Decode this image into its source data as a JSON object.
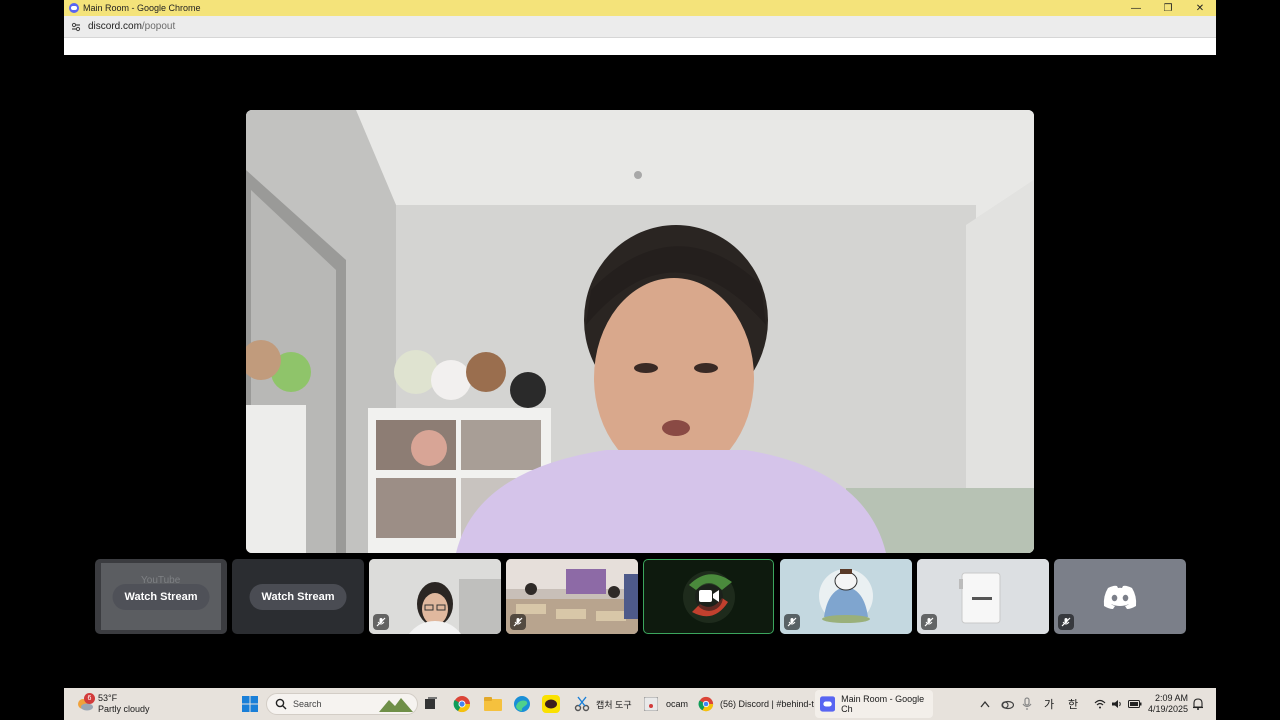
{
  "window": {
    "title": "Main Room - Google Chrome",
    "minimize_glyph": "—",
    "restore_glyph": "❐",
    "close_glyph": "✕"
  },
  "address": {
    "domain": "discord.com",
    "path": "/popout"
  },
  "tiles": [
    {
      "type": "stream",
      "label": "Watch Stream",
      "preview_text": "YouTube"
    },
    {
      "type": "stream",
      "label": "Watch Stream"
    },
    {
      "type": "camera",
      "muted": true
    },
    {
      "type": "camera",
      "muted": true
    },
    {
      "type": "camera-off",
      "selected": true
    },
    {
      "type": "avatar",
      "muted": true
    },
    {
      "type": "avatar",
      "muted": true
    },
    {
      "type": "discord-avatar",
      "muted": true
    }
  ],
  "taskbar": {
    "weather_badge": "6",
    "weather_temp": "53°F",
    "weather_desc": "Partly cloudy",
    "search_placeholder": "Search",
    "apps": [
      {
        "label": "캡처 도구"
      },
      {
        "label": "ocam"
      },
      {
        "label": "(56) Discord | #behind-t"
      },
      {
        "label": "Main Room - Google Ch"
      }
    ],
    "ime_1": "가",
    "ime_2": "한",
    "time": "2:09 AM",
    "date": "4/19/2025"
  },
  "colors": {
    "title_bar": "#f4e37a",
    "discord_blurple": "#5865f2",
    "tile_dark": "#2b2d31",
    "selected_border": "#3ba55d"
  }
}
